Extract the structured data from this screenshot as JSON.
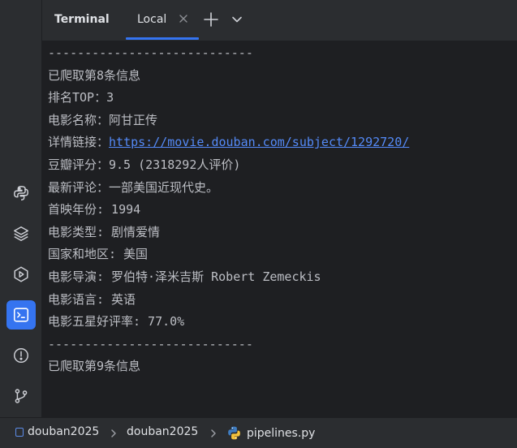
{
  "header": {
    "title": "Terminal",
    "tabs": [
      {
        "label": "Local",
        "active": true
      }
    ],
    "accent_color": "#3574f0"
  },
  "left_toolbar": {
    "items": [
      {
        "name": "python-console",
        "icon": "python-icon"
      },
      {
        "name": "python-packages",
        "icon": "layers-icon"
      },
      {
        "name": "services",
        "icon": "run-services-icon"
      },
      {
        "name": "terminal",
        "icon": "terminal-icon",
        "active": true
      },
      {
        "name": "problems",
        "icon": "warning-circle-icon"
      },
      {
        "name": "git",
        "icon": "git-branch-icon"
      }
    ]
  },
  "terminal": {
    "lines": [
      "----------------------------",
      "已爬取第8条信息",
      "排名TOP：3",
      "电影名称：阿甘正传",
      {
        "prefix": "详情链接：",
        "link": "https://movie.douban.com/subject/1292720/"
      },
      "豆瓣评分：9.5 (2318292人评价)",
      "最新评论：一部美国近现代史。",
      "首映年份: 1994",
      "电影类型: 剧情爱情",
      "国家和地区: 美国",
      "电影导演: 罗伯特·泽米吉斯 Robert Zemeckis",
      "电影语言: 英语",
      "电影五星好评率: 77.0%",
      "----------------------------",
      "已爬取第9条信息"
    ],
    "text_color": "#bcbec4",
    "link_color": "#548af7",
    "background": "#1e1f22"
  },
  "breadcrumb": {
    "items": [
      "douban2025",
      "douban2025",
      "pipelines.py"
    ]
  }
}
